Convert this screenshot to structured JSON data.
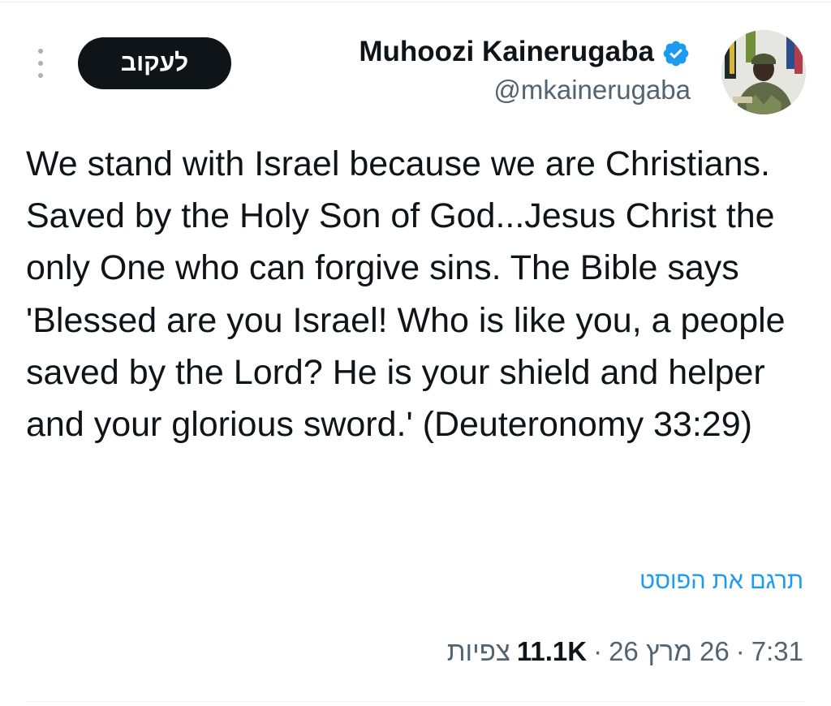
{
  "author": {
    "name": "Muhoozi Kainerugaba",
    "handle": "@mkainerugaba",
    "verified_icon": "verified-badge-icon",
    "verified_color": "#1d9bf0"
  },
  "header": {
    "follow_label": "לעקוב",
    "more_icon": "more-vertical-icon"
  },
  "tweet": {
    "text": "We stand with Israel because we are Christians. Saved by the Holy Son of God...Jesus Christ the only One who can forgive sins. The Bible says 'Blessed are you Israel! Who is like you, a people saved by the Lord? He is your shield and helper and your glorious sword.' (Deuteronomy 33:29)",
    "translate_label": "תרגם את הפוסט"
  },
  "meta": {
    "time": "7:31",
    "date": "26 מרץ 26",
    "views_count": "11.1K",
    "views_label": "צפיות",
    "separator": "·"
  },
  "colors": {
    "accent": "#1d9bf0",
    "text_primary": "#0f1419",
    "text_secondary": "#536471",
    "button_bg": "#0f1419"
  }
}
